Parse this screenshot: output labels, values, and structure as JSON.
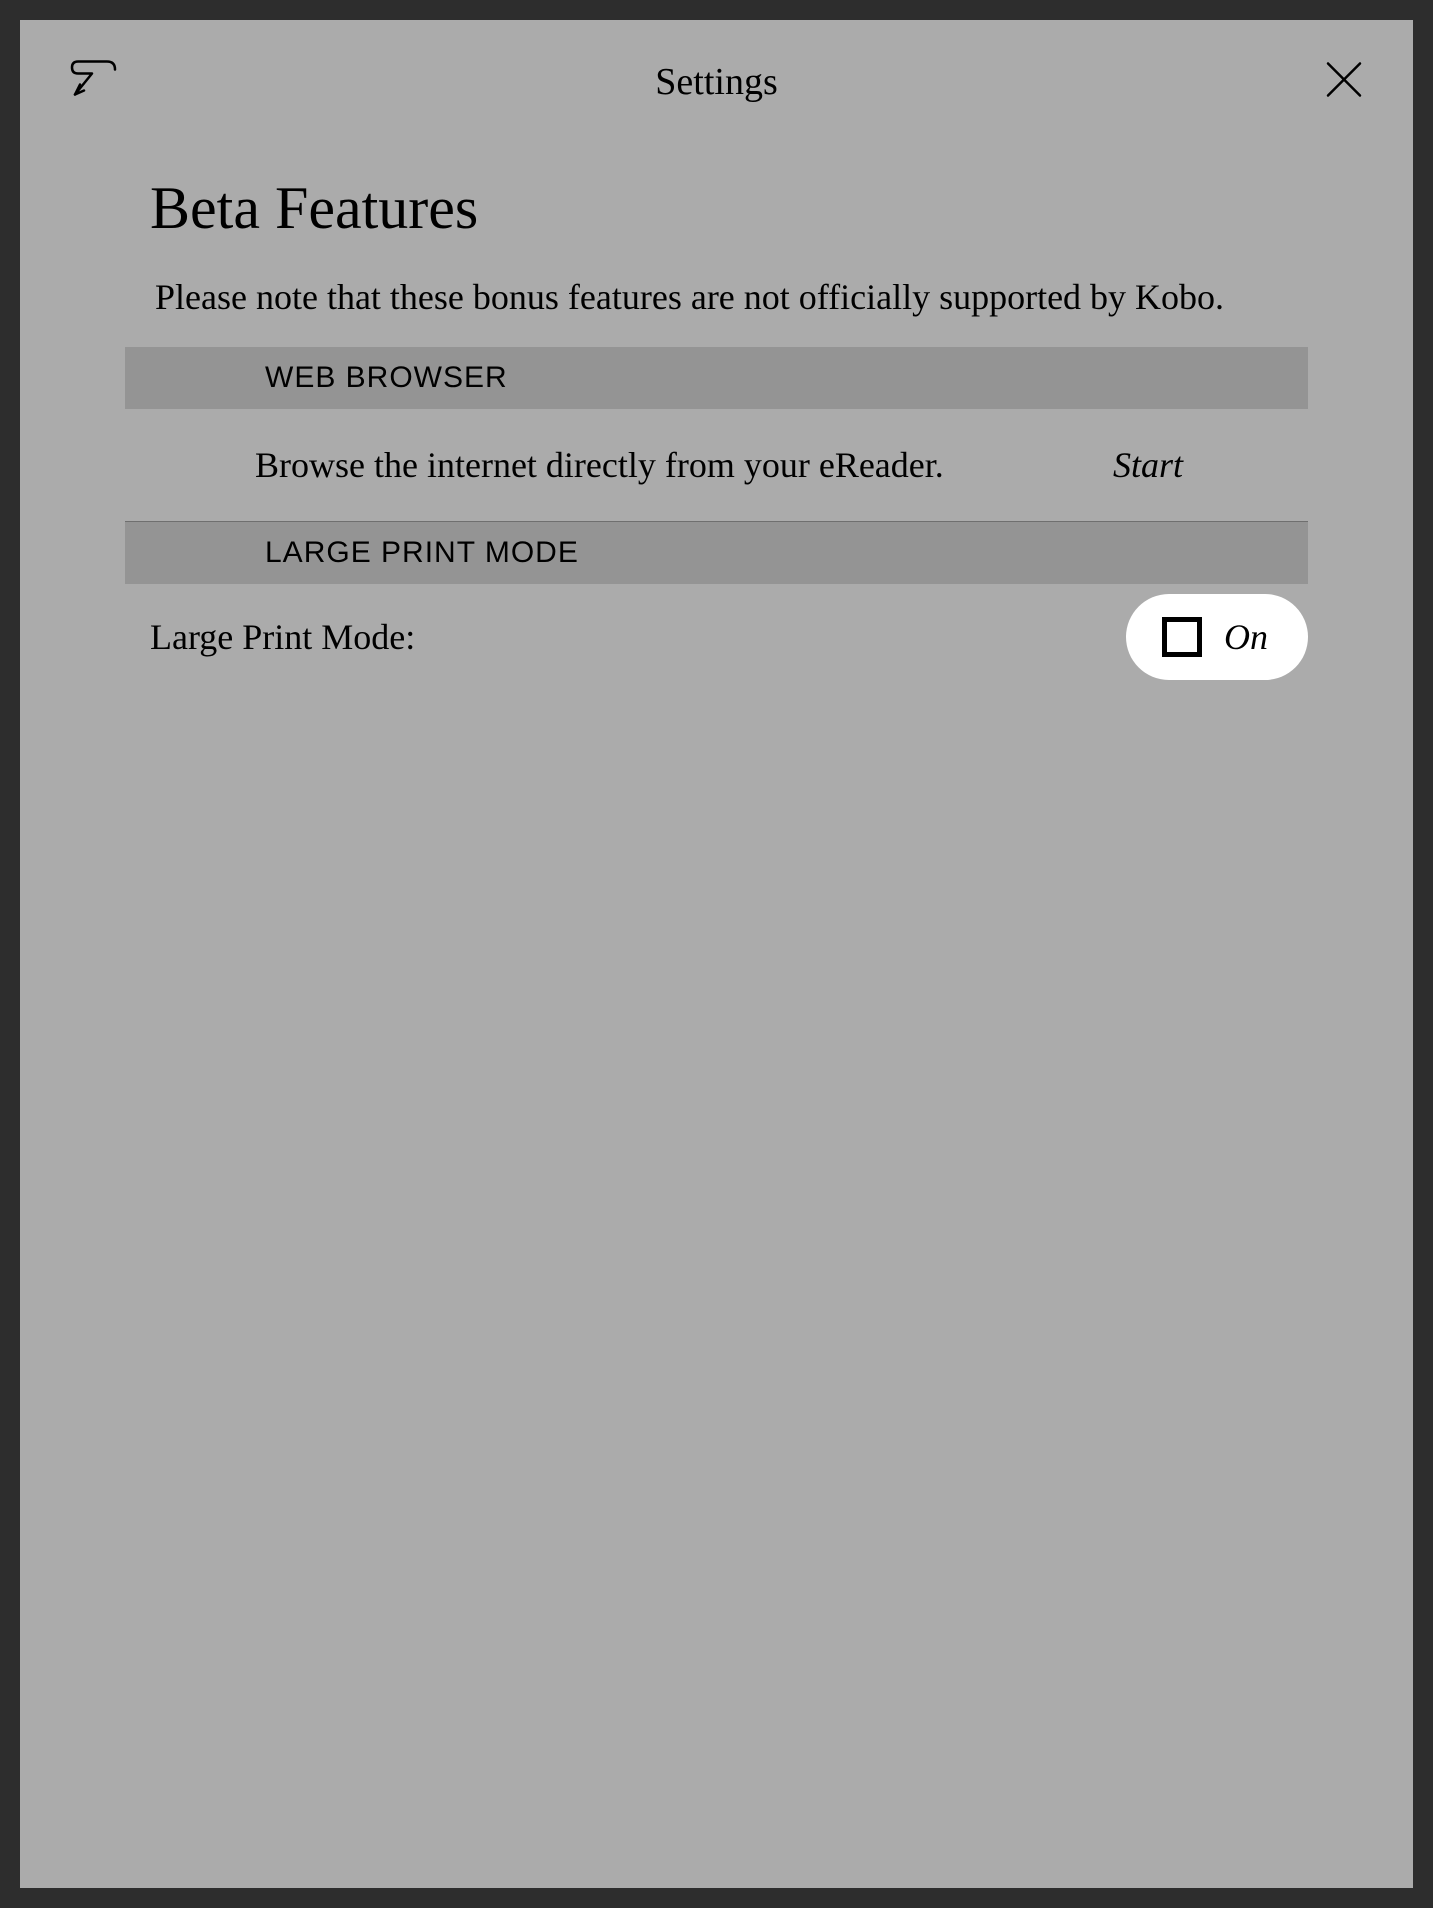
{
  "header": {
    "title": "Settings"
  },
  "page": {
    "title": "Beta Features",
    "disclaimer": "Please note that these bonus features are not officially supported by Kobo."
  },
  "sections": {
    "webBrowser": {
      "header": "WEB BROWSER",
      "description": "Browse the internet directly from your eReader.",
      "action": "Start"
    },
    "largePrint": {
      "header": "LARGE PRINT MODE",
      "label": "Large Print Mode:",
      "toggleState": "On"
    }
  }
}
